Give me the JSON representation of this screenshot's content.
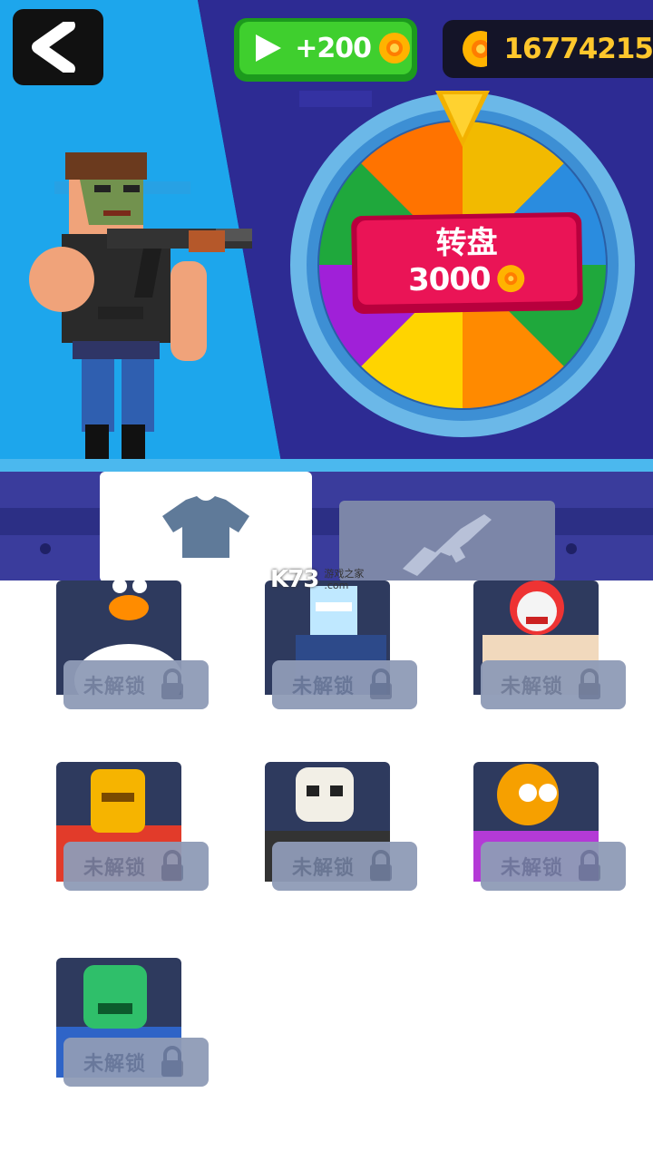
{
  "header": {
    "back_icon": "back-arrow-icon",
    "ad_reward": "+200",
    "coins": "16774215"
  },
  "wheel": {
    "title": "转盘",
    "cost": "3000",
    "segment_colors": [
      "#f2ba00",
      "#2a8cdf",
      "#1fa83c",
      "#ff8a00",
      "#ffd400",
      "#a020d8",
      "#1fa83c",
      "#ff7300"
    ]
  },
  "tabs": {
    "outfit": "shirt-icon",
    "weapon": "rifle-icon"
  },
  "watermark": {
    "logo": "K73",
    "cn": "游戏之家",
    "domain": ".com"
  },
  "characters": [
    {
      "name": "duck",
      "status": "未解锁"
    },
    {
      "name": "ice-robot",
      "status": "未解锁"
    },
    {
      "name": "clown",
      "status": "未解锁"
    },
    {
      "name": "spartan",
      "status": "未解锁"
    },
    {
      "name": "skeleton",
      "status": "未解锁"
    },
    {
      "name": "octopus",
      "status": "未解锁"
    },
    {
      "name": "zombie",
      "status": "未解锁"
    }
  ]
}
